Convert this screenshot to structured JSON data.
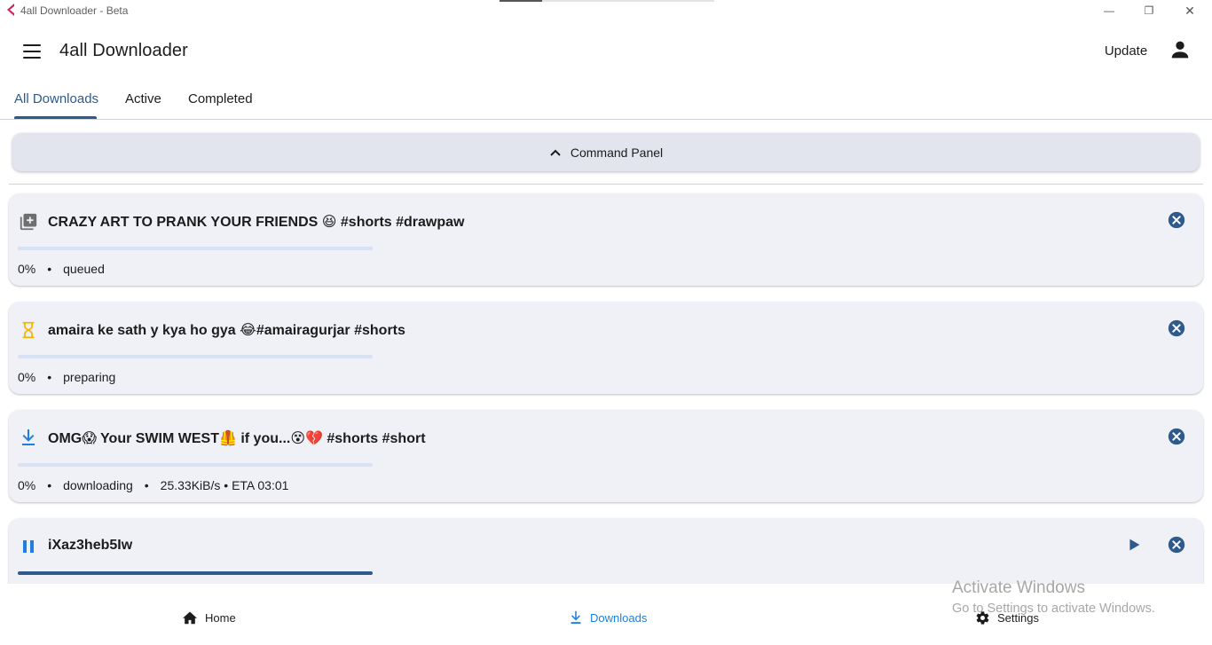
{
  "window": {
    "title": "4all Downloader - Beta",
    "minimize_glyph": "—",
    "restore_glyph": "❐",
    "close_glyph": "✕"
  },
  "appbar": {
    "title": "4all Downloader",
    "update_label": "Update"
  },
  "tabs": [
    {
      "label": "All Downloads",
      "active": true
    },
    {
      "label": "Active",
      "active": false
    },
    {
      "label": "Completed",
      "active": false
    }
  ],
  "command_panel": {
    "label": "Command Panel"
  },
  "downloads": [
    {
      "title": "CRAZY ART TO PRANK YOUR FRIENDS 😆 #shorts #drawpaw",
      "status_icon": "queue-icon",
      "percent": "0%",
      "status": "queued",
      "speed_eta": "",
      "progress": 0,
      "accent": "#6f6f6f"
    },
    {
      "title": "amaira ke sath y kya ho gya 😂#amairagurjar #shorts",
      "status_icon": "hourglass-icon",
      "percent": "0%",
      "status": "preparing",
      "speed_eta": "",
      "progress": 0,
      "accent": "#f5b400"
    },
    {
      "title": "OMG😱 Your SWIM WEST🦺 if you...😵💔 #shorts #short",
      "status_icon": "download-icon",
      "percent": "0%",
      "status": "downloading",
      "speed_eta": "25.33KiB/s • ETA 03:01",
      "progress": 0,
      "accent": "#1f7fe0"
    },
    {
      "title": "iXaz3heb5Iw",
      "status_icon": "pause-icon",
      "percent": "",
      "status": "",
      "speed_eta": "",
      "progress": 1,
      "accent": "#1f7fe0"
    }
  ],
  "bottom_nav": [
    {
      "label": "Home",
      "icon": "home-icon",
      "active": false
    },
    {
      "label": "Downloads",
      "icon": "download-icon",
      "active": true
    },
    {
      "label": "Settings",
      "icon": "gear-icon",
      "active": false
    }
  ],
  "watermark": {
    "line1": "Activate Windows",
    "line2": "Go to Settings to activate Windows."
  },
  "colors": {
    "primary": "#2f5a8c",
    "active_nav": "#1f7fe0",
    "card_bg": "#eff1f7"
  }
}
